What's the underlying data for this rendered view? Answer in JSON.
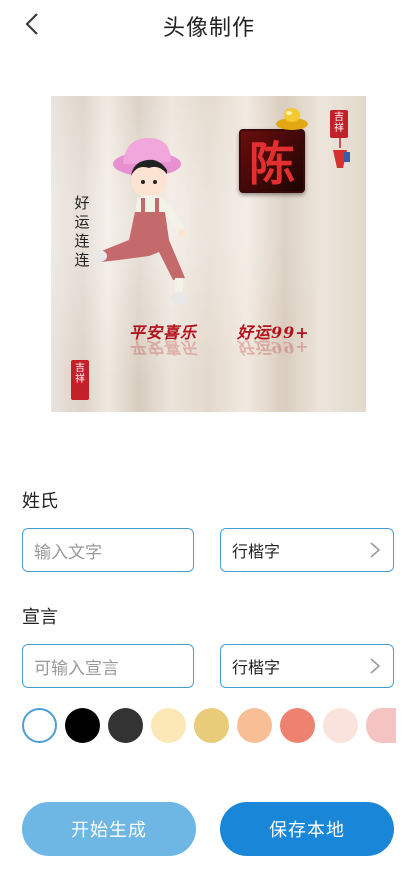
{
  "header": {
    "title": "头像制作"
  },
  "preview": {
    "surname_char": "陈",
    "vertical_text": [
      "好",
      "运",
      "连",
      "连"
    ],
    "slogan_left": "平安喜乐",
    "slogan_right": "好运99+",
    "seal_top": "吉祥",
    "seal_bottom": "吉祥"
  },
  "form": {
    "surname_label": "姓氏",
    "surname_placeholder": "输入文字",
    "surname_font": "行楷字",
    "slogan_label": "宣言",
    "slogan_placeholder": "可输入宣言",
    "slogan_font": "行楷字"
  },
  "colors": {
    "accent": "#4a9fd8",
    "swatches": [
      "#ffffff",
      "#000000",
      "#333333",
      "#fbe8b6",
      "#e8cc79",
      "#f8bf97",
      "#ee8270",
      "#fbe3dd",
      "#f6c3c3"
    ],
    "selected_index": 0
  },
  "actions": {
    "generate_label": "开始生成",
    "save_label": "保存本地"
  }
}
